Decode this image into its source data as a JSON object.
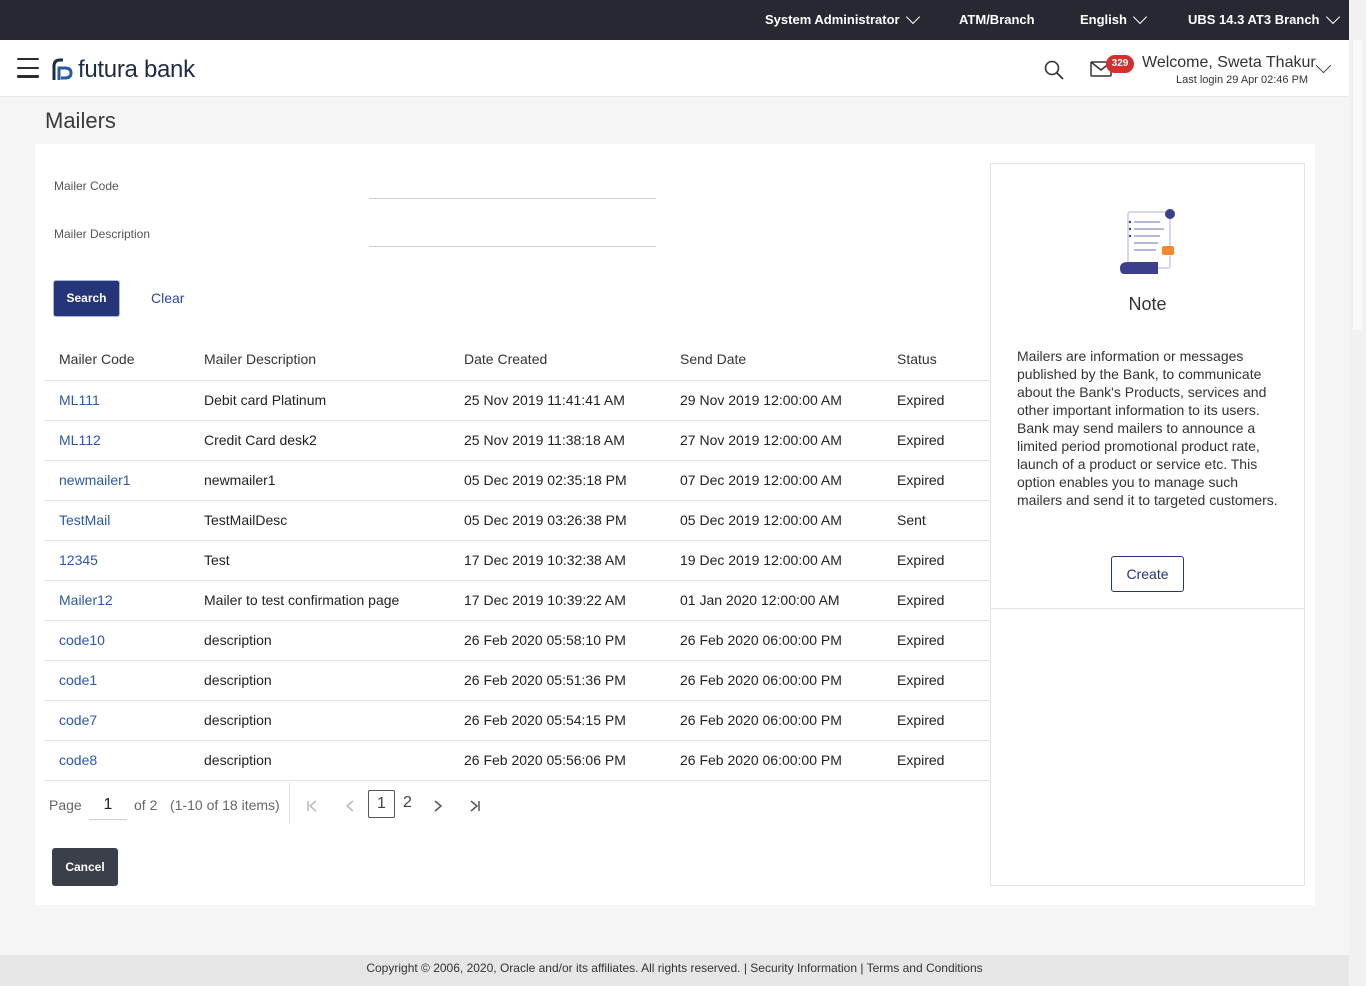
{
  "topbar": {
    "role": "System Administrator",
    "atm_branch": "ATM/Branch",
    "language": "English",
    "branch": "UBS 14.3 AT3 Branch"
  },
  "header": {
    "brand": "futura bank",
    "mail_count": "329",
    "welcome": "Welcome, Sweta Thakur",
    "last_login": "Last login 29 Apr 02:46 PM"
  },
  "page": {
    "title": "Mailers"
  },
  "form": {
    "mailer_code_label": "Mailer Code",
    "mailer_code_value": "",
    "mailer_description_label": "Mailer Description",
    "mailer_description_value": "",
    "search_label": "Search",
    "clear_label": "Clear"
  },
  "table": {
    "headers": [
      "Mailer Code",
      "Mailer Description",
      "Date Created",
      "Send Date",
      "Status"
    ],
    "rows": [
      [
        "ML111",
        "Debit card Platinum",
        "25 Nov 2019 11:41:41 AM",
        "29 Nov 2019 12:00:00 AM",
        "Expired"
      ],
      [
        "ML112",
        "Credit Card desk2",
        "25 Nov 2019 11:38:18 AM",
        "27 Nov 2019 12:00:00 AM",
        "Expired"
      ],
      [
        "newmailer1",
        "newmailer1",
        "05 Dec 2019 02:35:18 PM",
        "07 Dec 2019 12:00:00 AM",
        "Expired"
      ],
      [
        "TestMail",
        "TestMailDesc",
        "05 Dec 2019 03:26:38 PM",
        "05 Dec 2019 12:00:00 AM",
        "Sent"
      ],
      [
        "12345",
        "Test",
        "17 Dec 2019 10:32:38 AM",
        "19 Dec 2019 12:00:00 AM",
        "Expired"
      ],
      [
        "Mailer12",
        "Mailer to test confirmation page",
        "17 Dec 2019 10:39:22 AM",
        "01 Jan 2020 12:00:00 AM",
        "Expired"
      ],
      [
        "code10",
        "description",
        "26 Feb 2020 05:58:10 PM",
        "26 Feb 2020 06:00:00 PM",
        "Expired"
      ],
      [
        "code1",
        "description",
        "26 Feb 2020 05:51:36 PM",
        "26 Feb 2020 06:00:00 PM",
        "Expired"
      ],
      [
        "code7",
        "description",
        "26 Feb 2020 05:54:15 PM",
        "26 Feb 2020 06:00:00 PM",
        "Expired"
      ],
      [
        "code8",
        "description",
        "26 Feb 2020 05:56:06 PM",
        "26 Feb 2020 06:00:00 PM",
        "Expired"
      ]
    ]
  },
  "pagination": {
    "page_label": "Page",
    "current_page": "1",
    "of_label": "of 2",
    "items_label": "(1-10 of 18 items)",
    "pages": [
      "1",
      "2"
    ]
  },
  "actions": {
    "cancel_label": "Cancel"
  },
  "note": {
    "title": "Note",
    "text": "Mailers are information or messages published by the Bank, to communicate about the Bank's Products, services and other important information to its users. Bank may send mailers to announce a limited period promotional product rate, launch of a product or service etc. This option enables you to manage such mailers and send it to targeted customers.",
    "create_label": "Create"
  },
  "footer": {
    "copyright": "Copyright © 2006, 2020, Oracle and/or its affiliates. All rights reserved.",
    "security_link": "Security Information",
    "terms_link": "Terms and Conditions"
  },
  "colors": {
    "primary": "#253579",
    "link": "#2b58a6",
    "topbar": "#262932",
    "badge": "#d32f2f"
  }
}
